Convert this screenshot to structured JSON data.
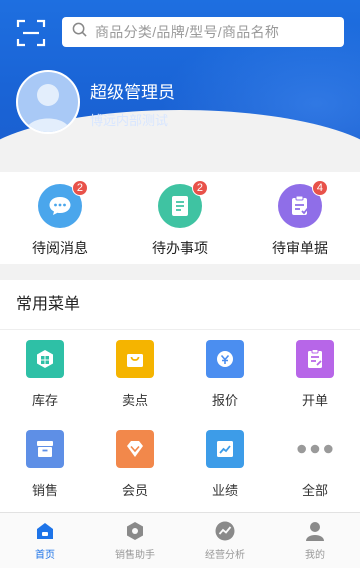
{
  "header": {
    "search_placeholder": "商品分类/品牌/型号/商品名称",
    "user_name": "超级管理员",
    "user_org": "博远内部测试"
  },
  "pending": [
    {
      "label": "待阅消息",
      "badge": "2",
      "color": "#4aa6ec",
      "icon": "message-icon"
    },
    {
      "label": "待办事项",
      "badge": "2",
      "color": "#3fc3a2",
      "icon": "todo-icon"
    },
    {
      "label": "待审单据",
      "badge": "4",
      "color": "#8f6ee8",
      "icon": "document-review-icon"
    }
  ],
  "menu": {
    "title": "常用菜单",
    "items": [
      {
        "label": "库存",
        "color": "#2ec0a6",
        "icon": "inventory-icon"
      },
      {
        "label": "卖点",
        "color": "#f5b400",
        "icon": "shopping-bag-icon"
      },
      {
        "label": "报价",
        "color": "#4b8ef0",
        "icon": "quote-icon"
      },
      {
        "label": "开单",
        "color": "#b766e8",
        "icon": "create-order-icon"
      },
      {
        "label": "销售",
        "color": "#5e8fe6",
        "icon": "sales-icon"
      },
      {
        "label": "会员",
        "color": "#f2884b",
        "icon": "member-icon"
      },
      {
        "label": "业绩",
        "color": "#3d9ce8",
        "icon": "performance-icon"
      },
      {
        "label": "全部",
        "color": "#9a9a9a",
        "icon": "more-icon"
      }
    ]
  },
  "tabs": [
    {
      "label": "首页",
      "active": true,
      "icon": "home-icon"
    },
    {
      "label": "销售助手",
      "active": false,
      "icon": "sales-assistant-icon"
    },
    {
      "label": "经营分析",
      "active": false,
      "icon": "analysis-icon"
    },
    {
      "label": "我的",
      "active": false,
      "icon": "profile-icon"
    }
  ],
  "colors": {
    "primary": "#1e74e8",
    "badge": "#e8524a"
  }
}
